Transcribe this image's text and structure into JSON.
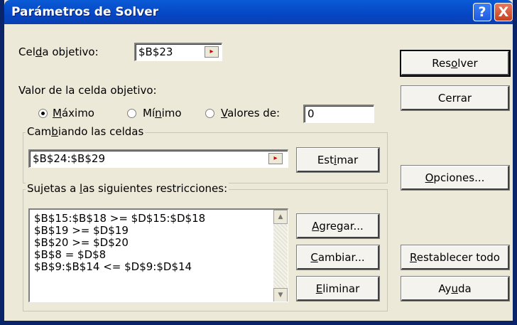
{
  "window": {
    "title": "Parámetros de Solver",
    "help_glyph": "?",
    "close_glyph": "X"
  },
  "target": {
    "label_pre": "Cel",
    "label_u": "d",
    "label_post": "a objetivo:",
    "value": "$B$23"
  },
  "objective": {
    "label": "Valor de la celda objetivo:",
    "options": [
      {
        "u": "M",
        "rest": "áximo",
        "selected": true
      },
      {
        "pre": "Mí",
        "u": "n",
        "rest": "imo",
        "selected": false
      },
      {
        "u": "V",
        "rest": "alores de:",
        "selected": false
      }
    ],
    "value": "0"
  },
  "changing": {
    "title_pre": "Cam",
    "title_u": "b",
    "title_post": "iando las celdas",
    "value": "$B$24:$B$29"
  },
  "constraints": {
    "title_pre": "Sujetas a ",
    "title_u": "l",
    "title_post": "as siguientes restricciones:",
    "items": [
      "$B$15:$B$18 >= $D$15:$D$18",
      "$B$19 >= $D$19",
      "$B$20 >= $D$20",
      "$B$8 = $D$8",
      "$B$9:$B$14 <= $D$9:$D$14"
    ]
  },
  "buttons": {
    "solve": {
      "pre": "Res",
      "u": "o",
      "post": "lver"
    },
    "close": {
      "pre": "Cerrar",
      "u": "",
      "post": ""
    },
    "guess": {
      "pre": "Est",
      "u": "i",
      "post": "mar"
    },
    "options": {
      "pre": "",
      "u": "O",
      "post": "pciones..."
    },
    "add": {
      "pre": "",
      "u": "A",
      "post": "gregar..."
    },
    "change": {
      "pre": "",
      "u": "C",
      "post": "ambiar..."
    },
    "reset": {
      "pre": "",
      "u": "R",
      "post": "establecer todo"
    },
    "delete": {
      "pre": "",
      "u": "E",
      "post": "liminar"
    },
    "help": {
      "pre": "Ay",
      "u": "u",
      "post": "da"
    }
  }
}
